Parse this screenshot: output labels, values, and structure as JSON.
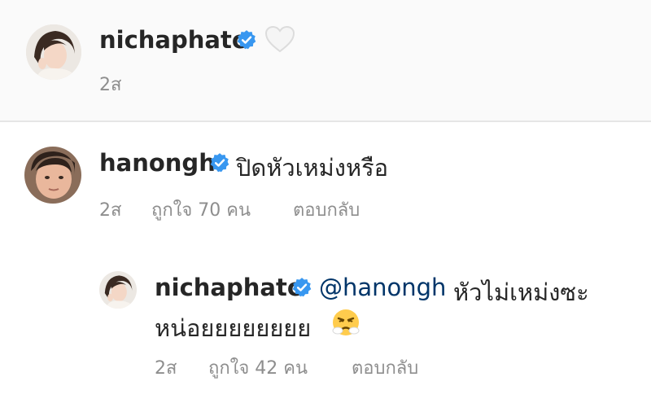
{
  "post_caption": {
    "username": "nichaphatc",
    "verified_icon": "verified-badge-icon",
    "like_icon": "heart-outline-icon",
    "time": "2ส"
  },
  "comment": {
    "username": "hanongh",
    "verified_icon": "verified-badge-icon",
    "text": "ปิดหัวเหม่งหรือ",
    "time": "2ส",
    "likes": "ถูกใจ 70 คน",
    "reply_label": "ตอบกลับ"
  },
  "reply": {
    "username": "nichaphatc",
    "verified_icon": "verified-badge-icon",
    "mention": "@hanongh",
    "text_line1": "หัวไม่เหม่งซะ",
    "text_line2": "หน่อยยยยยยยย",
    "emoji": "steam-from-nose-emoji",
    "time": "2ส",
    "likes": "ถูกใจ 42 คน",
    "reply_label": "ตอบกลับ"
  },
  "colors": {
    "verified": "#3897f0",
    "meta_text": "#8e8e8e",
    "mention": "#003569"
  }
}
